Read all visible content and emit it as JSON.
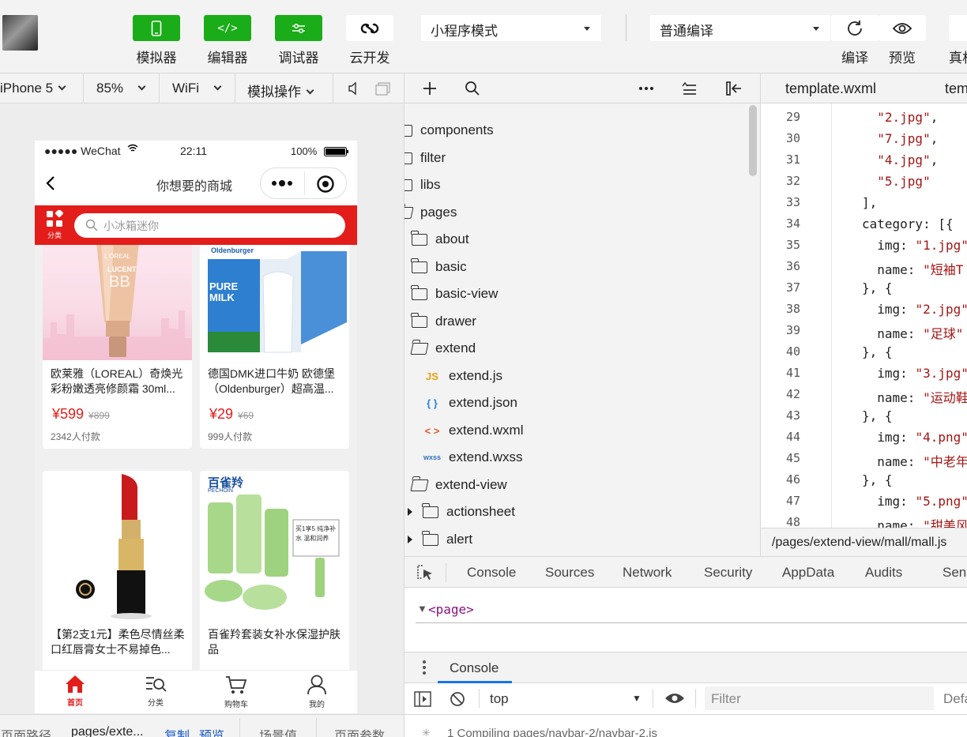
{
  "toolbar": {
    "simulator": "模拟器",
    "editor": "编辑器",
    "debugger": "调试器",
    "cloud": "云开发",
    "mode_select": "小程序模式",
    "compile_select": "普通编译",
    "compile": "编译",
    "preview": "预览",
    "real_device": "真机"
  },
  "sim_bar": {
    "device": "iPhone 5",
    "zoom": "85%",
    "network": "WiFi",
    "sim_ops": "模拟操作"
  },
  "phone": {
    "carrier": "●●●●● WeChat",
    "time": "22:11",
    "battery": "100%",
    "nav_title": "你想要的商城",
    "category_label": "分类",
    "search_placeholder": "小冰箱迷你",
    "products": [
      {
        "title": "欧莱雅（LOREAL）奇焕光彩粉嫩透亮修颜霜 30ml...",
        "price": "¥599",
        "old_price": "¥899",
        "sold": "2342人付款"
      },
      {
        "title": "德国DMK进口牛奶 欧德堡（Oldenburger）超高温...",
        "price": "¥29",
        "old_price": "¥69",
        "sold": "999人付款"
      },
      {
        "title": "【第2支1元】柔色尽情丝柔口红唇膏女士不易掉色...",
        "price": "",
        "old_price": "",
        "sold": ""
      },
      {
        "title": "百雀羚套装女补水保湿护肤品",
        "price": "",
        "old_price": "",
        "sold": ""
      }
    ],
    "product_image_text": {
      "loreal_brand": "L'OREAL",
      "loreal_name": "LUCENT",
      "loreal_code": "BB",
      "milk_brand": "Oldenburger",
      "milk_name": "PURE MILK",
      "pechoin_brand": "百雀羚",
      "pechoin_latin": "PECHOIN",
      "pechoin_promo": "买1享5 纯净补水 温和润养"
    },
    "tabs": [
      "首页",
      "分类",
      "购物车",
      "我的"
    ]
  },
  "tree": {
    "items": [
      "components",
      "filter",
      "libs",
      "pages",
      "about",
      "basic",
      "basic-view",
      "drawer",
      "extend",
      "extend.js",
      "extend.json",
      "extend.wxml",
      "extend.wxss",
      "extend-view",
      "actionsheet",
      "alert"
    ],
    "file_icons": {
      "js": "JS",
      "json": "{ }",
      "wxml": "< >",
      "wxss": "wxss"
    }
  },
  "editor": {
    "tabs": [
      "template.wxml",
      "tem"
    ],
    "lines": [
      {
        "n": "29",
        "code": "  \"2.jpg\","
      },
      {
        "n": "30",
        "code": "  \"7.jpg\","
      },
      {
        "n": "31",
        "code": "  \"4.jpg\","
      },
      {
        "n": "32",
        "code": "  \"5.jpg\""
      },
      {
        "n": "33",
        "code": "],"
      },
      {
        "n": "34",
        "code": "category: [{"
      },
      {
        "n": "35",
        "code": "  img: \"1.jpg\""
      },
      {
        "n": "36",
        "code": "  name: \"短袖T"
      },
      {
        "n": "37",
        "code": "}, {"
      },
      {
        "n": "38",
        "code": "  img: \"2.jpg\""
      },
      {
        "n": "39",
        "code": "  name: \"足球\""
      },
      {
        "n": "40",
        "code": "}, {"
      },
      {
        "n": "41",
        "code": "  img: \"3.jpg\""
      },
      {
        "n": "42",
        "code": "  name: \"运动鞋"
      },
      {
        "n": "43",
        "code": "}, {"
      },
      {
        "n": "44",
        "code": "  img: \"4.png\""
      },
      {
        "n": "45",
        "code": "  name: \"中老年"
      },
      {
        "n": "46",
        "code": "}, {"
      },
      {
        "n": "47",
        "code": "  img: \"5.png\""
      },
      {
        "n": "48",
        "code": "  name: \"甜美风"
      }
    ],
    "status_path": "/pages/extend-view/mall/mall.js"
  },
  "devtools": {
    "tabs": [
      "Console",
      "Sources",
      "Network",
      "Security",
      "AppData",
      "Audits",
      "Senso"
    ],
    "page_node": "<page>",
    "drawer_tab": "Console",
    "context": "top",
    "filter_placeholder": "Filter",
    "levels": "Defa",
    "log_line": "1 Compiling pages/navbar-2/navbar-2.js"
  },
  "bottom_bar": {
    "path_label": "页面路径",
    "path_value": "pages/exte...",
    "copy": "复制",
    "preview": "预览",
    "scene": "场景值",
    "params": "页面参数"
  },
  "colors": {
    "accent_green": "#1aad19",
    "brand_red": "#e31d1a"
  }
}
